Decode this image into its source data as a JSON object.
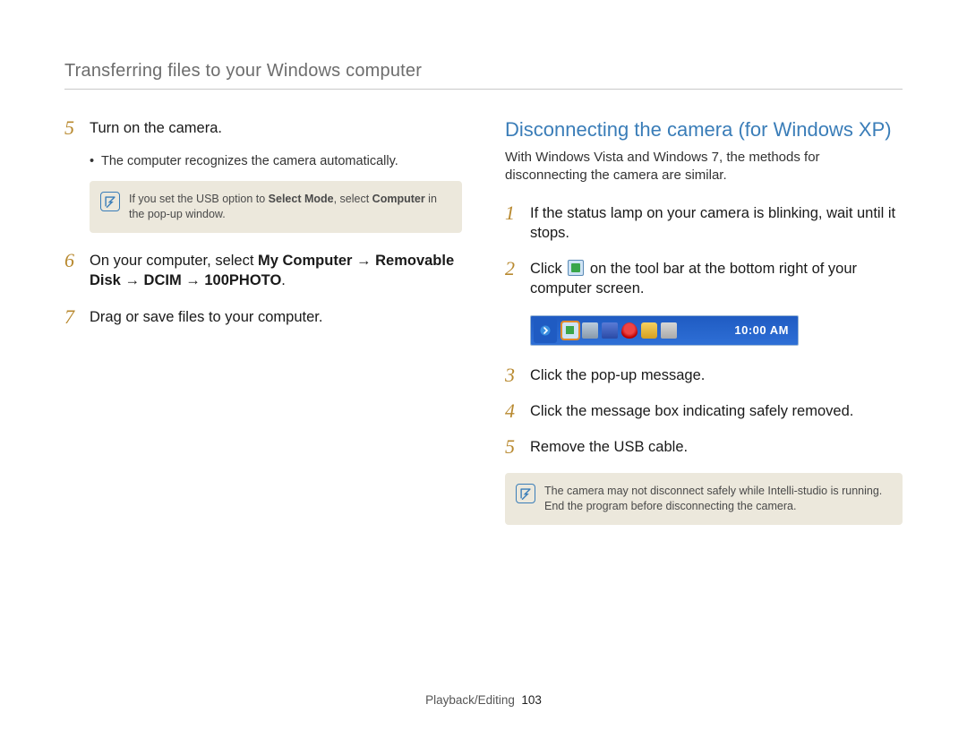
{
  "header": {
    "title": "Transferring files to your Windows computer"
  },
  "left": {
    "step5": {
      "num": "5",
      "text": "Turn on the camera."
    },
    "bullet5": "The computer recognizes the camera automatically.",
    "note5": {
      "pre": "If you set the USB option to ",
      "b1": "Select Mode",
      "mid": ", select ",
      "b2": "Computer",
      "post": " in the pop-up window."
    },
    "step6": {
      "num": "6",
      "pre": "On your computer, select ",
      "b1": "My Computer",
      "arrow1": " → ",
      "b2": "Removable Disk",
      "arrow2": " → ",
      "b3": "DCIM",
      "arrow3": " → ",
      "b4": "100PHOTO",
      "post": "."
    },
    "step7": {
      "num": "7",
      "text": "Drag or save files to your computer."
    }
  },
  "right": {
    "title": "Disconnecting the camera (for Windows XP)",
    "sub": "With Windows Vista and Windows 7, the methods for disconnecting the camera are similar.",
    "step1": {
      "num": "1",
      "text": "If the status lamp on your camera is blinking, wait until it stops."
    },
    "step2": {
      "num": "2",
      "pre": "Click ",
      "post": " on the tool bar at the bottom right of your computer screen."
    },
    "taskbar": {
      "clock": "10:00 AM"
    },
    "step3": {
      "num": "3",
      "text": "Click the pop-up message."
    },
    "step4": {
      "num": "4",
      "text": "Click the message box indicating safely removed."
    },
    "step5": {
      "num": "5",
      "text": "Remove the USB cable."
    },
    "note": "The camera may not disconnect safely while Intelli-studio is running. End the program before disconnecting the camera."
  },
  "footer": {
    "section": "Playback/Editing",
    "page": "103"
  }
}
